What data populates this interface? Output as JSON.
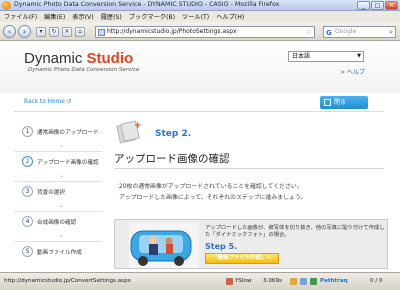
{
  "window": {
    "title": "Dynamic Photo Data Conversion Service - DYNAMIC STUDIO - CASIO - Mozilla Firefox",
    "min": "_",
    "max": "□",
    "close": "✕"
  },
  "menu": [
    "ファイル(F)",
    "編集(E)",
    "表示(V)",
    "履歴(S)",
    "ブックマーク(B)",
    "ツール(T)",
    "ヘルプ(H)"
  ],
  "nav": {
    "url": "http://dynamicstudio.jp/PhotoSettings.aspx",
    "search_placeholder": "Google"
  },
  "header": {
    "logo_left": "Dynamic ",
    "logo_right": "Studio",
    "tagline": "Dynamic Photo Data Conversion Service",
    "language": "日本語",
    "help": "> ヘルプ"
  },
  "toolbar": {
    "back_to_home": "Back to Home",
    "close": "閉る"
  },
  "steps": [
    {
      "num": "1",
      "label": "通常画像のアップロード"
    },
    {
      "num": "2",
      "label": "アップロード画像の確認"
    },
    {
      "num": "3",
      "label": "背景の選択"
    },
    {
      "num": "4",
      "label": "合成画像の確認"
    },
    {
      "num": "5",
      "label": "動画ファイル作成"
    }
  ],
  "main": {
    "step_label": "Step 2.",
    "title": "アップロード画像の確認",
    "desc1": "20枚の通常画像がアップロードされていることを確認してください。",
    "desc2": "アップロードした画像によって、それぞれのステップに進みましょう。"
  },
  "promo": {
    "text": "アップロードした画像が、被写体を切り抜き、他の写真に貼り付けて作成した「ダイナミックフォト」の場合。",
    "step": "Step 5.",
    "button": "「動画ファイル作成」へ"
  },
  "status": {
    "url": "http://dynamicstudio.jp/ConvertSettings.aspx",
    "yslow": "YSlow",
    "time": "3.069s",
    "pathtraq": "Pathtraq",
    "count": "0 / 0"
  },
  "colors": {
    "accent": "#2a73c8",
    "brand": "#e8411f",
    "button": "#1f8ed6"
  }
}
